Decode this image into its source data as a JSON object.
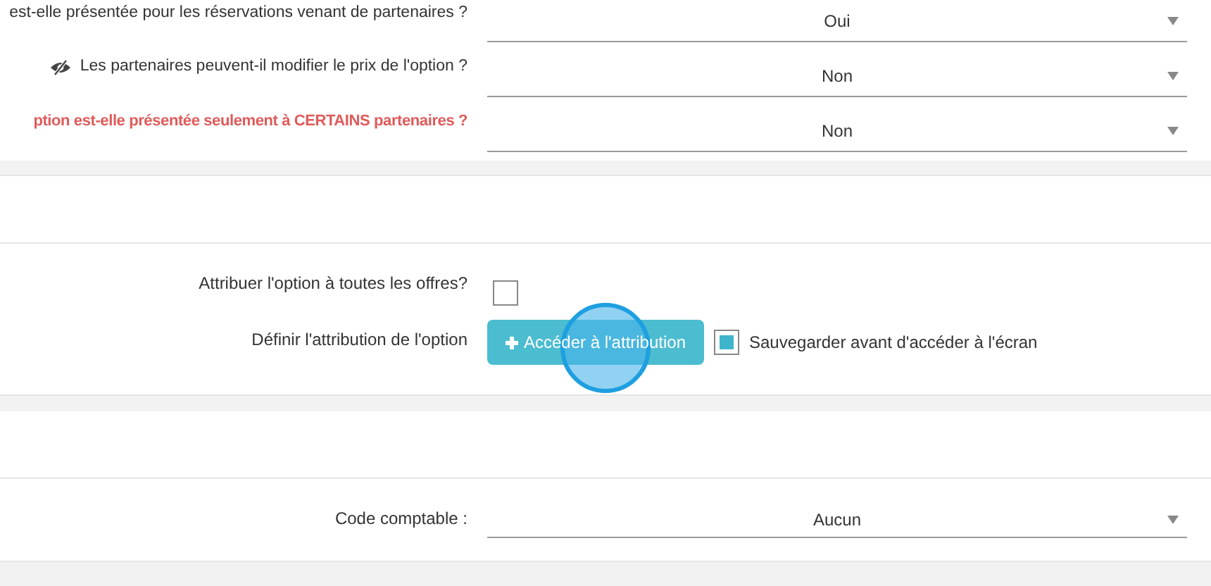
{
  "partner_settings": [
    {
      "kind": "plain",
      "label": "est-elle présentée pour les réservations venant de partenaires ?",
      "value": "Oui"
    },
    {
      "kind": "flagged",
      "label": "Les partenaires peuvent-il modifier le prix de l'option ?",
      "value": "Non"
    },
    {
      "kind": "alert",
      "label": "ption est-elle présentée seulement à CERTAINS partenaires ?",
      "value": "Non"
    }
  ],
  "attribution": {
    "all_offers": {
      "label": "Attribuer l'option à toutes les offres?",
      "checked": false
    },
    "define": {
      "label": "Définir l'attribution de l'option",
      "button": "Accéder à l'attribution"
    },
    "save_first": {
      "label": "Sauvegarder avant d'accéder à l'écran",
      "checked": true
    }
  },
  "accounting": {
    "label": "Code comptable :",
    "value": "Aucun"
  }
}
